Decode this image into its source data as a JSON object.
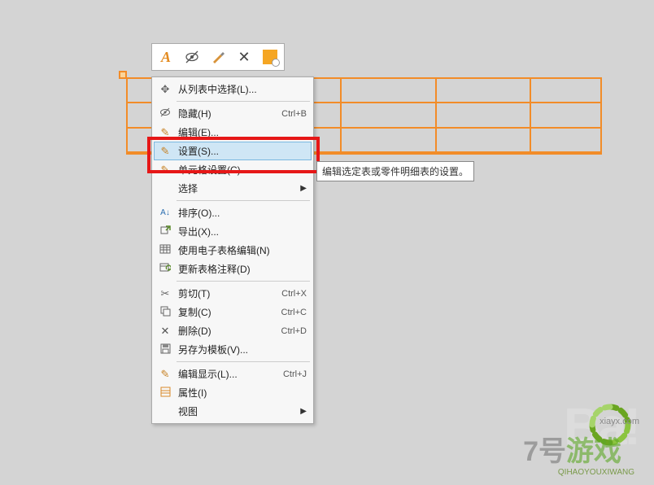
{
  "toolbar": {
    "text_style_icon": "A",
    "visibility_icon": "◎",
    "brush_icon": "✎",
    "close_icon": "✕",
    "note_icon": "note"
  },
  "menu": {
    "select_from_list": "从列表中选择(L)...",
    "hide": "隐藏(H)",
    "hide_shortcut": "Ctrl+B",
    "edit": "编辑(E)...",
    "settings": "设置(S)...",
    "cell_settings": "单元格设置(C)...",
    "select": "选择",
    "sort": "排序(O)...",
    "export": "导出(X)...",
    "use_spreadsheet_edit": "使用电子表格编辑(N)",
    "update_table_annotation": "更新表格注释(D)",
    "cut": "剪切(T)",
    "cut_shortcut": "Ctrl+X",
    "copy": "复制(C)",
    "copy_shortcut": "Ctrl+C",
    "delete": "删除(D)",
    "delete_shortcut": "Ctrl+D",
    "save_as_template": "另存为模板(V)...",
    "edit_display": "编辑显示(L)...",
    "edit_display_shortcut": "Ctrl+J",
    "properties": "属性(I)",
    "view": "视图"
  },
  "tooltip": "编辑选定表或零件明细表的设置。",
  "watermark": {
    "main": "7号游戏",
    "url": "xiayx.com",
    "tag": "QIHAOYOUXIWANG",
    "bg": "Ba!"
  }
}
